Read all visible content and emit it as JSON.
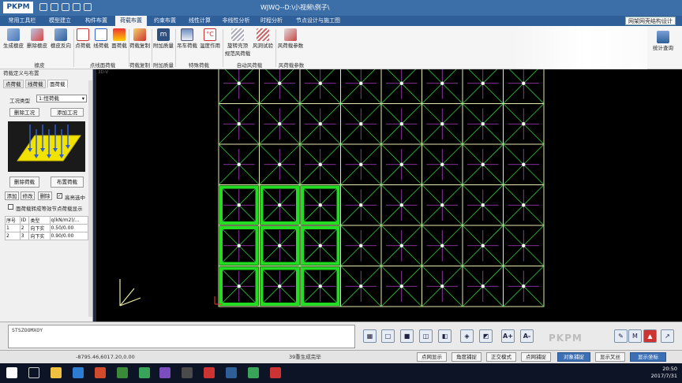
{
  "app": {
    "logo_text": "PKPM",
    "window_title": "WJWQ--D:\\小视频\\例子\\"
  },
  "menu": {
    "tabs": [
      {
        "label": "常用工具栏"
      },
      {
        "label": "模型建立"
      },
      {
        "label": "构件布置"
      },
      {
        "label": "荷载布置"
      },
      {
        "label": "约束布置"
      },
      {
        "label": "线性计算"
      },
      {
        "label": "非线性分析"
      },
      {
        "label": "时程分析"
      },
      {
        "label": "节点设计与施工图"
      }
    ],
    "active_index": 3,
    "right_label": "网架网壳结构设计"
  },
  "ribbon": {
    "buttons": [
      {
        "label": "生成檩皮"
      },
      {
        "label": "删除檩皮"
      },
      {
        "label": "檩皮反向"
      },
      {
        "label": "点荷载"
      },
      {
        "label": "线荷载"
      },
      {
        "label": "面荷载"
      },
      {
        "label": "荷载复制"
      },
      {
        "label": "附加质量"
      },
      {
        "label": "吊车荷载"
      },
      {
        "label": "温度作用"
      },
      {
        "label": "旋转壳顶"
      },
      {
        "label": "风洞试验"
      },
      {
        "label": "风荷载参数"
      }
    ],
    "extra_label": "规范风荷载",
    "groups": [
      "檩皮",
      "点线面荷载",
      "荷载复制",
      "附加质量",
      "特殊荷载",
      "自动风荷载",
      "风荷载参数"
    ],
    "stats_label": "统计查询"
  },
  "left_panel": {
    "title": "荷载定义与布置",
    "tabs": [
      "点荷载",
      "线荷载",
      "面荷载"
    ],
    "active_tab": 2,
    "case_type_label": "工况类型",
    "case_type_value": "1:恒荷载",
    "delete_case": "删除工况",
    "add_case": "添加工况",
    "delete_load": "删除荷载",
    "place_load": "布置荷载",
    "add": "添加",
    "modify": "修改",
    "delete": "删除",
    "highlight": "高亮选中",
    "convert_option": "面荷载转成等效节点荷载显示",
    "table": {
      "headers": [
        "序号",
        "ID",
        "类型",
        "q(kN/m2)/..."
      ],
      "rows": [
        [
          "1",
          "2",
          "向下实",
          "0.50/0.00"
        ],
        [
          "2",
          "3",
          "向下实",
          "0.90/0.00"
        ]
      ]
    }
  },
  "viewport": {
    "tag": "3D-V"
  },
  "command": {
    "text": "STSZOOMXOY"
  },
  "watermark": "PKPM",
  "status": {
    "coords": "-8795.46,6017.20,0.00",
    "message": "39重生成完毕",
    "buttons": [
      {
        "label": "点网显示",
        "on": false
      },
      {
        "label": "角度捕捉",
        "on": false
      },
      {
        "label": "正交模式",
        "on": false
      },
      {
        "label": "点网捕捉",
        "on": false
      },
      {
        "label": "对象捕捉",
        "on": true
      },
      {
        "label": "显示叉丝",
        "on": false
      },
      {
        "label": "显示坐标",
        "on": true
      }
    ]
  },
  "taskbar": {
    "time": "20:50",
    "date": "2017/7/31"
  },
  "colors": {
    "grid_line": "#e6e6b0",
    "diagonal": "#2ecc40",
    "purple": "#b040c8",
    "highlight": "#22dd22",
    "active_status": "#3d6fb5"
  }
}
